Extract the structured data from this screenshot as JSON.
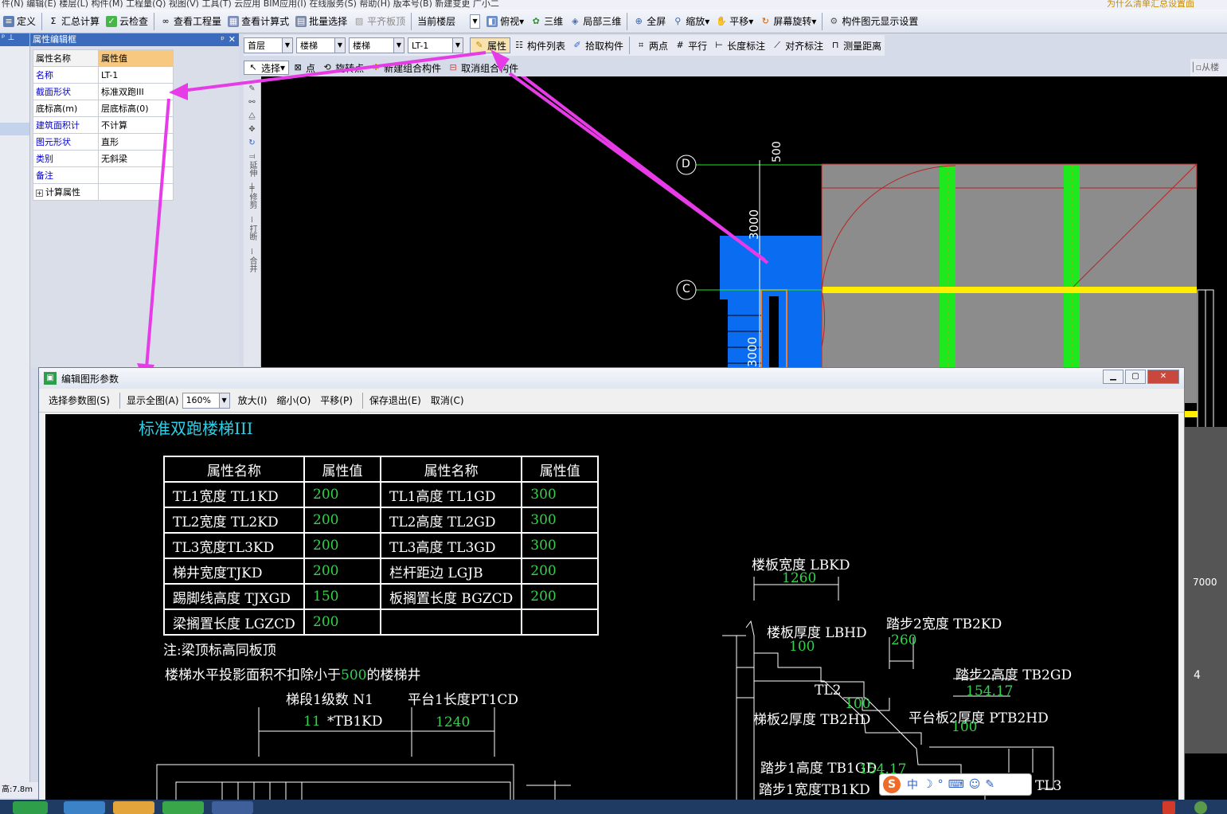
{
  "menu": {
    "items_text": "件(N)  编辑(E)  楼层(L)  构件(M)  工程量(Q)  视图(V)  工具(T)  云应用  BIM应用(I)  在线服务(S)  帮助(H)  版本号(B)  新建变更  广小二",
    "right_text": "为什么清单汇总设置面"
  },
  "toolbar": {
    "items": [
      "定义",
      "汇总计算",
      "云检查",
      "查看工程量",
      "查看计算式",
      "批量选择",
      "平齐板顶",
      "当前楼层",
      "俯视",
      "三维",
      "局部三维",
      "全屏",
      "缩放",
      "平移",
      "屏幕旋转",
      "构件图元显示设置"
    ]
  },
  "panel": {
    "title": "属性编辑框",
    "header": {
      "name": "属性名称",
      "value": "属性值"
    },
    "rows": [
      {
        "name": "名称",
        "value": "LT-1"
      },
      {
        "name": "截面形状",
        "value": "标准双跑III"
      },
      {
        "name": "底标高(m)",
        "value": "层底标高(0)"
      },
      {
        "name": "建筑面积计",
        "value": "不计算"
      },
      {
        "name": "图元形状",
        "value": "直形"
      },
      {
        "name": "类别",
        "value": "无斜梁"
      },
      {
        "name": "备注",
        "value": ""
      },
      {
        "name": "计算属性",
        "value": ""
      }
    ]
  },
  "selectors": {
    "floor": "首层",
    "type1": "楼梯",
    "type2": "楼梯",
    "component": "LT-1"
  },
  "row2_buttons": [
    "属性",
    "构件列表",
    "拾取构件",
    "两点",
    "平行",
    "长度标注",
    "对齐标注",
    "测量距离"
  ],
  "row3_buttons": [
    "选择",
    "点",
    "旋转点",
    "新建组合构件",
    "取消组合构件"
  ],
  "right_edge": {
    "text": "从楼"
  },
  "side_tools": [
    "延伸",
    "修剪",
    "打断",
    "合并"
  ],
  "cad": {
    "axis_d": "D",
    "axis_c": "C",
    "axis_4": "4",
    "dim_500": "500",
    "dim_3000": "3000",
    "dim_3000b": "3000",
    "dim_right": "7000"
  },
  "dialog": {
    "title": "编辑图形参数",
    "tools": [
      "选择参数图(S)",
      "显示全图(A)",
      "160%",
      "放大(I)",
      "缩小(O)",
      "平移(P)",
      "保存退出(E)",
      "取消(C)"
    ],
    "heading": "标准双跑楼梯III",
    "table_headers": [
      "属性名称",
      "属性值",
      "属性名称",
      "属性值"
    ],
    "table_rows": [
      [
        "TL1宽度 TL1KD",
        "200",
        "TL1高度 TL1GD",
        "300"
      ],
      [
        "TL2宽度 TL2KD",
        "200",
        "TL2高度 TL2GD",
        "300"
      ],
      [
        "TL3宽度TL3KD",
        "200",
        "TL3高度 TL3GD",
        "300"
      ],
      [
        "梯井宽度TJKD",
        "200",
        "栏杆距边 LGJB",
        "200"
      ],
      [
        "踢脚线高度 TJXGD",
        "150",
        "板搁置长度 BGZCD",
        "200"
      ],
      [
        "梁搁置长度 LGZCD",
        "200",
        "",
        ""
      ]
    ],
    "note1": "注:梁顶标高同板顶",
    "note2a": "楼梯水平投影面积不扣除小于",
    "note2v": "500",
    "note2b": "的楼梯井",
    "n1_label": "梯段1级数 N1",
    "n1_value": "11",
    "n1_mult": "*TB1KD",
    "pt1_label": "平台1长度PT1CD",
    "pt1_value": "1240",
    "lbkd_label": "楼板宽度 LBKD",
    "lbkd_value": "1260",
    "lbhd_label": "楼板厚度 LBHD",
    "lbhd_value": "100",
    "tb2kd_label": "踏步2宽度 TB2KD",
    "tb2kd_value": "260",
    "tb2gd_label": "踏步2高度 TB2GD",
    "tb2gd_value": "154.17",
    "tl2": "TL2",
    "tb2hd_label": "梯板2厚度 TB2HD",
    "tb2hd_value": "100",
    "ptb2hd_label": "平台板2厚度 PTB2HD",
    "ptb2hd_value": "100",
    "tb1gd_label": "踏步1高度 TB1GD",
    "tb1gd_value": "154.17",
    "tb1kd_label": "踏步1宽度TB1KD",
    "tl3": "TL3"
  },
  "status": {
    "text": "高:7.8m"
  },
  "ime": {
    "text": "中"
  },
  "colors": {
    "accent_arrow": "#e83be8",
    "cad_blue": "#0a6cf0",
    "cad_green": "#1ee81e",
    "cad_yellow": "#ffee00",
    "param_green": "#33d24c"
  }
}
